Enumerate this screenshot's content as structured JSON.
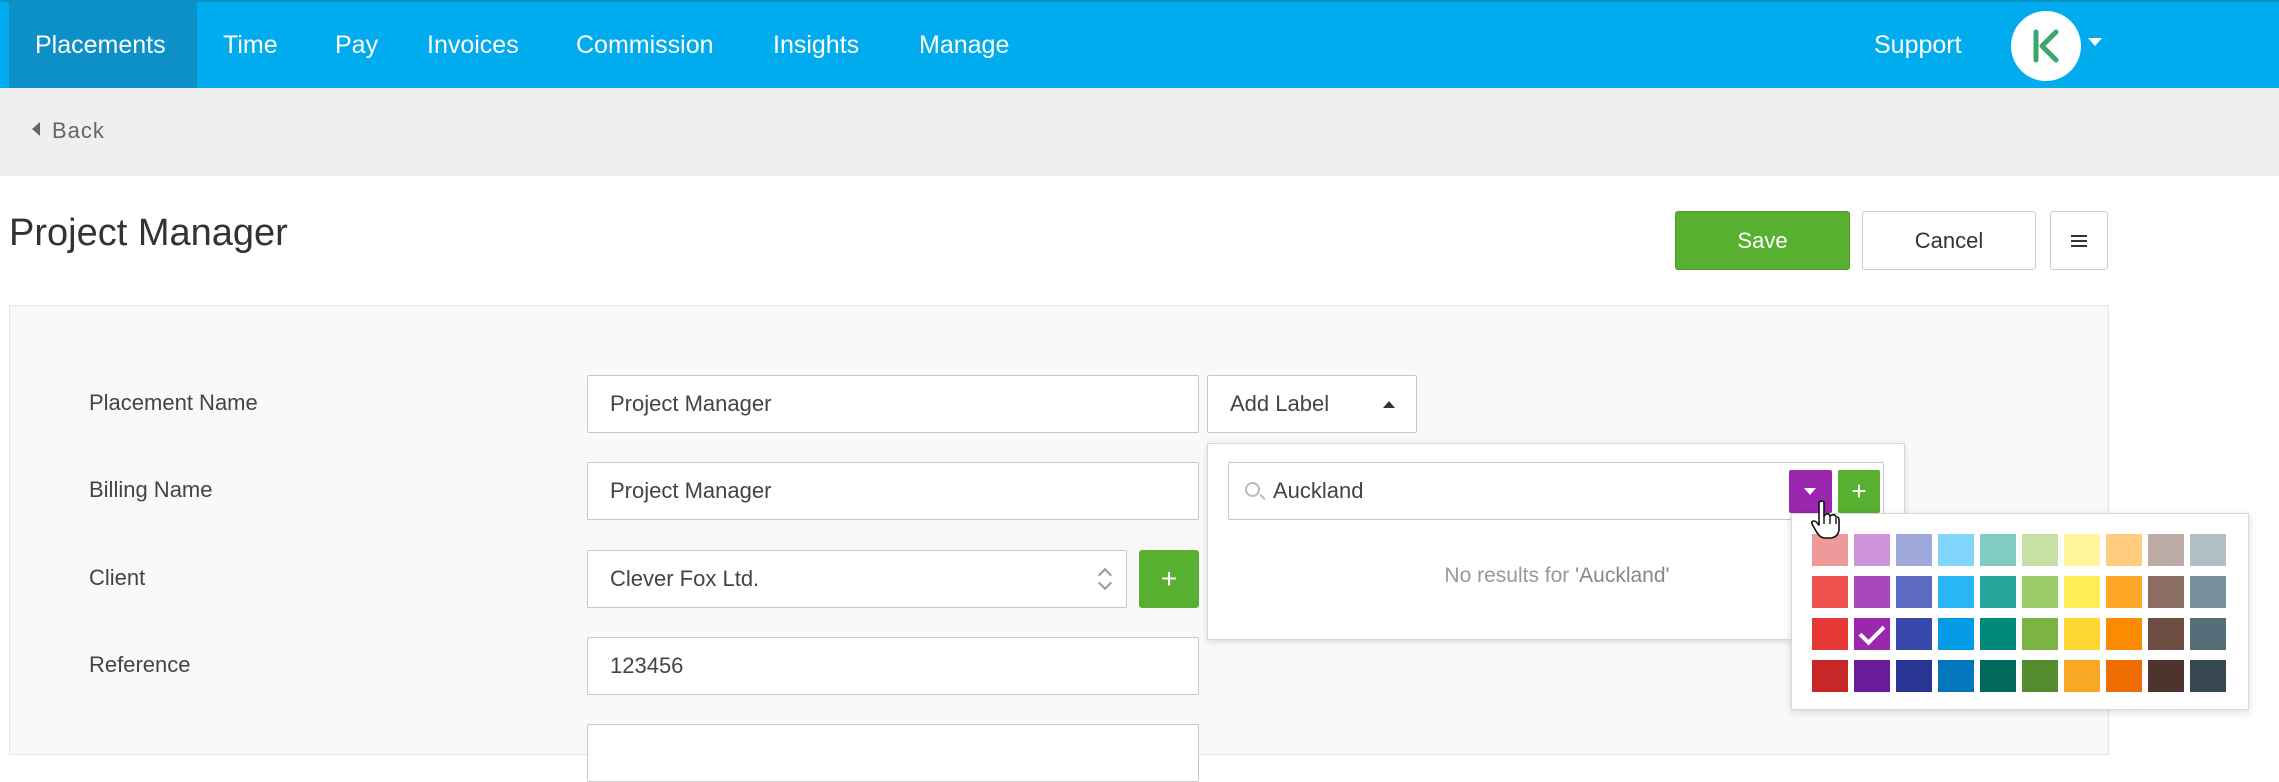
{
  "nav": {
    "items": [
      {
        "label": "Placements",
        "active": true
      },
      {
        "label": "Time",
        "active": false
      },
      {
        "label": "Pay",
        "active": false
      },
      {
        "label": "Invoices",
        "active": false
      },
      {
        "label": "Commission",
        "active": false
      },
      {
        "label": "Insights",
        "active": false
      },
      {
        "label": "Manage",
        "active": false
      }
    ],
    "support": "Support",
    "avatar_icon": "user-avatar-icon"
  },
  "back": "Back",
  "page": {
    "title": "Project Manager",
    "save": "Save",
    "cancel": "Cancel"
  },
  "form": {
    "placement_name_label": "Placement Name",
    "placement_name_value": "Project Manager",
    "billing_name_label": "Billing Name",
    "billing_name_value": "Project Manager",
    "client_label": "Client",
    "client_value": "Clever Fox Ltd.",
    "client_add": "+",
    "reference_label": "Reference",
    "reference_value": "123456",
    "add_label": "Add Label"
  },
  "label_dropdown": {
    "search_value": "Auckland",
    "add": "+",
    "no_results_prefix": "No results for ",
    "no_results_query": "'Auckland'",
    "selected_color": "#9b27af"
  },
  "palette": {
    "rows": [
      [
        "#ef9a9a",
        "#ce93d8",
        "#9fa8da",
        "#81d4fa",
        "#80cbc4",
        "#c5e1a5",
        "#fff59d",
        "#ffcc80",
        "#bcaaa4",
        "#b0bec5"
      ],
      [
        "#ef5350",
        "#ab47bc",
        "#5c6bc0",
        "#29b6f6",
        "#26a69a",
        "#9ccc65",
        "#ffee58",
        "#ffa726",
        "#8d6e63",
        "#78909c"
      ],
      [
        "#e53935",
        "#9b27af",
        "#3949ab",
        "#039be5",
        "#00897b",
        "#7cb342",
        "#fdd835",
        "#fb8c00",
        "#6d4c41",
        "#546e7a"
      ],
      [
        "#c62828",
        "#6a1b9a",
        "#283593",
        "#0277bd",
        "#00695c",
        "#558b2f",
        "#f9a825",
        "#ef6c00",
        "#4e342e",
        "#37474f"
      ]
    ],
    "selected_row": 2,
    "selected_col": 1
  }
}
